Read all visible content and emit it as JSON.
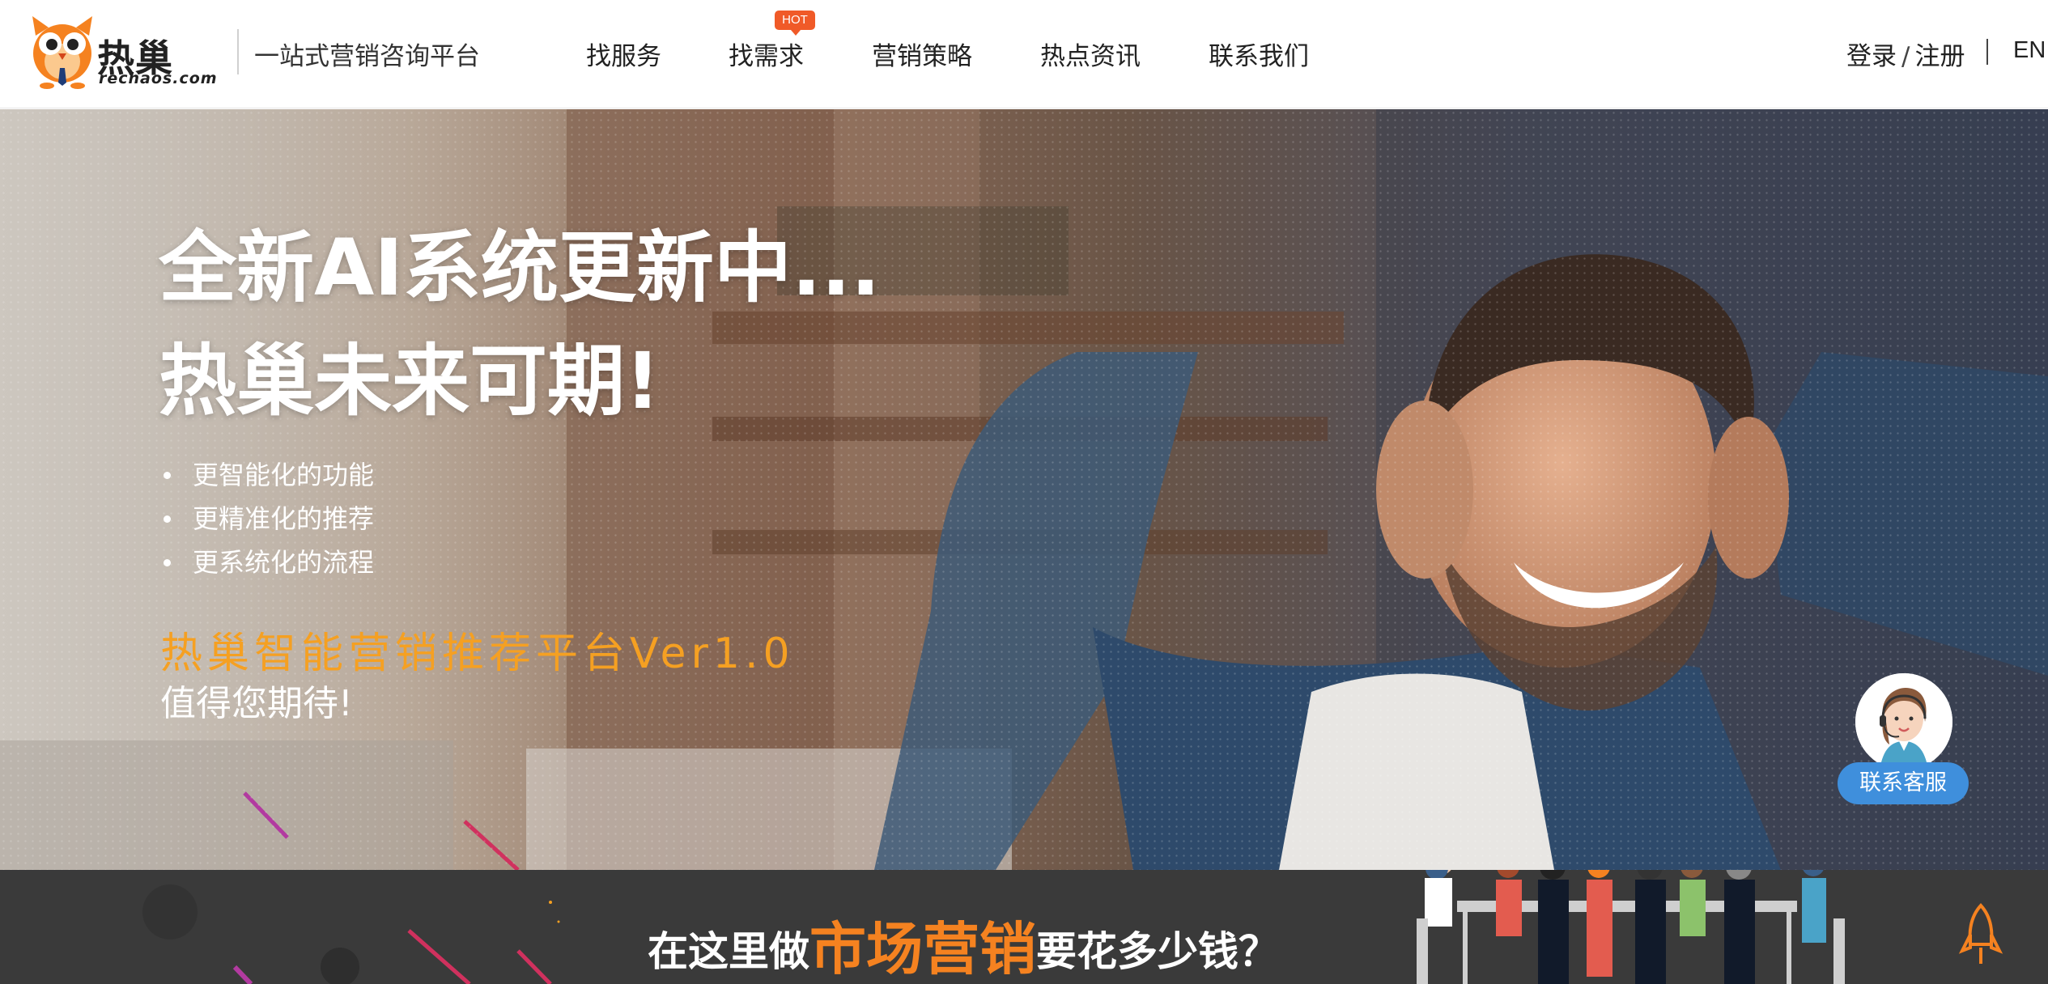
{
  "header": {
    "logo_text": "热巢",
    "logo_domain": "rechaos.com",
    "slogan": "一站式营销咨询平台",
    "nav": [
      {
        "label": "找服务"
      },
      {
        "label": "找需求",
        "badge": "HOT"
      },
      {
        "label": "营销策略"
      },
      {
        "label": "热点资讯"
      },
      {
        "label": "联系我们"
      }
    ],
    "login": "登录",
    "separator": "/",
    "register": "注册",
    "language": "EN"
  },
  "hero": {
    "title_line1": "全新AI系统更新中...",
    "title_line2": "热巢未来可期!",
    "features": [
      "更智能化的功能",
      "更精准化的推荐",
      "更系统化的流程"
    ],
    "highlight": "热巢智能营销推荐平台Ver1.0",
    "subtitle": "值得您期待!"
  },
  "customer_service": {
    "label": "联系客服",
    "icon": "headset-agent-icon"
  },
  "banner": {
    "text_before": "在这里做",
    "text_highlight": "市场营销",
    "text_after": "要花多少钱？"
  },
  "colors": {
    "accent_orange": "#f58220",
    "highlight_yellow": "#f5a022",
    "hot_badge": "#f05a28",
    "service_blue": "#3f8fdc",
    "banner_bg": "#3a3a3a"
  }
}
